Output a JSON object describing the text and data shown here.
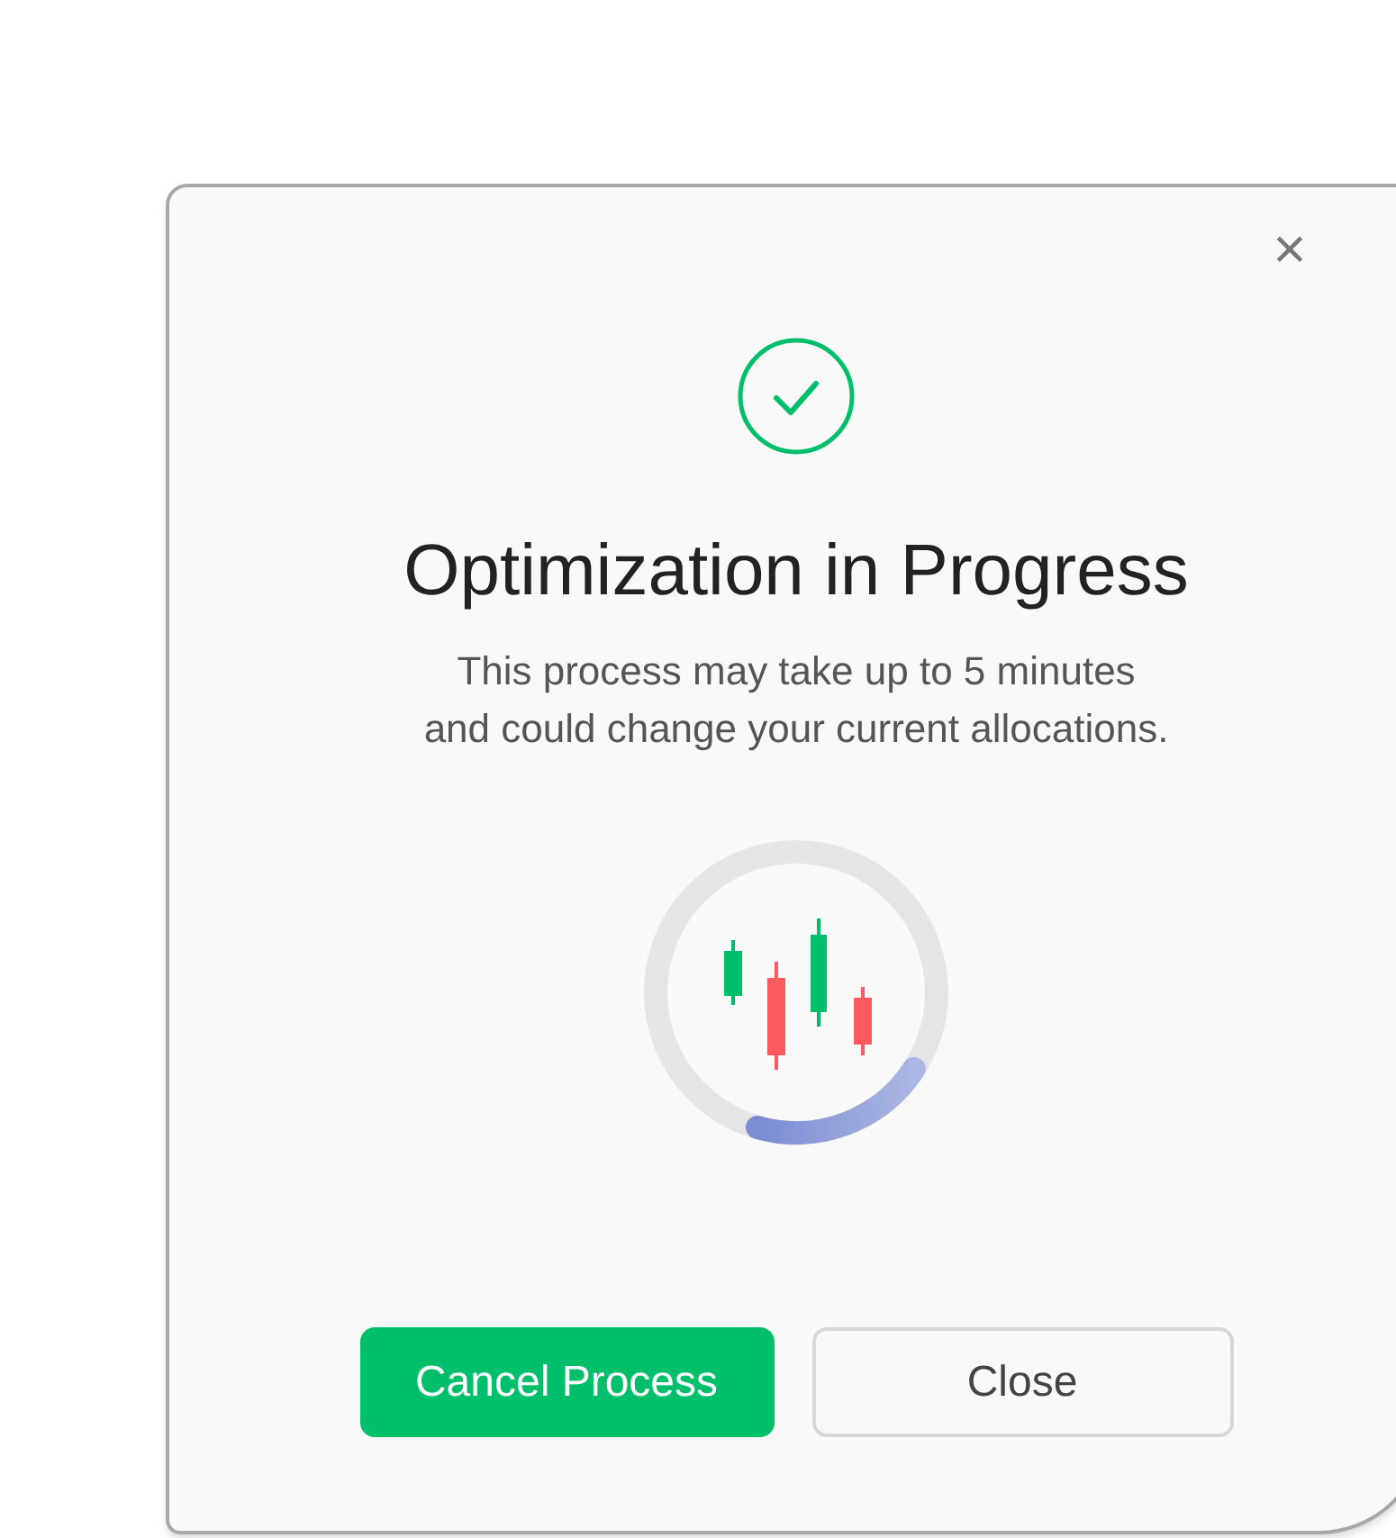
{
  "dialog": {
    "title": "Optimization in Progress",
    "message_lines": [
      "This process may take up to 5 minutes",
      "and could change your current allocations."
    ],
    "close_icon": "×",
    "buttons": [
      {
        "label": "Cancel Process",
        "kind": "primary"
      },
      {
        "label": "Close",
        "kind": "secondary"
      }
    ]
  }
}
